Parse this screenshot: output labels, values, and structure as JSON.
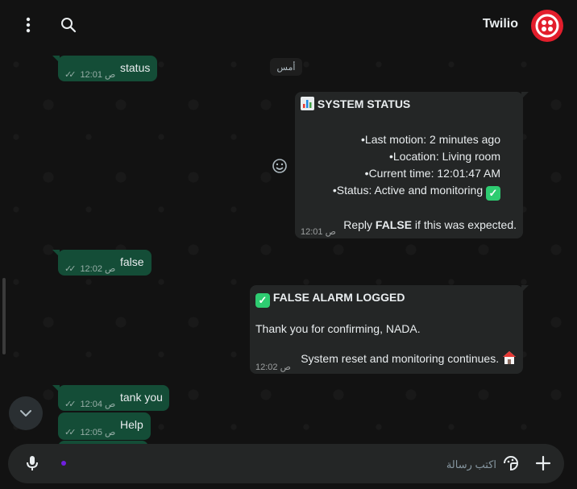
{
  "header": {
    "title": "Twilio"
  },
  "date_separator": "أمس",
  "messages": {
    "out_status": {
      "text": "status",
      "time": "12:01 ص"
    },
    "in_system": {
      "title": "SYSTEM STATUS",
      "lines": [
        "•Last motion: 2 minutes ago",
        "•Location: Living room",
        "•Current time: 12:01:47 AM",
        "•Status: Active and monitoring"
      ],
      "reply_prefix": "Reply ",
      "reply_bold": "FALSE",
      "reply_suffix": " if this was expected.",
      "time": "12:01 ص"
    },
    "out_false": {
      "text": "false",
      "time": "12:02 ص"
    },
    "in_alarm": {
      "title": "FALSE ALARM LOGGED",
      "line1": "Thank you for confirming, NADA.",
      "line2": "System reset and monitoring continues.",
      "time": "12:02 ص"
    },
    "out_tank": {
      "text": "tank you",
      "time": "12:04 ص"
    },
    "out_help": {
      "text": "Help",
      "time": "12:05 ص"
    }
  },
  "composer": {
    "placeholder": "اكتب رسالة",
    "value": ""
  },
  "colors": {
    "outgoing": "#144d37",
    "incoming": "#242626",
    "avatar": "#e31e2c",
    "accent_dot": "#6f1fe0"
  },
  "icons": [
    "menu-dots-icon",
    "search-icon",
    "twilio-logo",
    "emoji-icon",
    "chevron-down-icon",
    "mic-icon",
    "sticker-icon",
    "plus-icon",
    "double-check-icon",
    "chart-emoji",
    "check-emoji",
    "house-emoji"
  ]
}
